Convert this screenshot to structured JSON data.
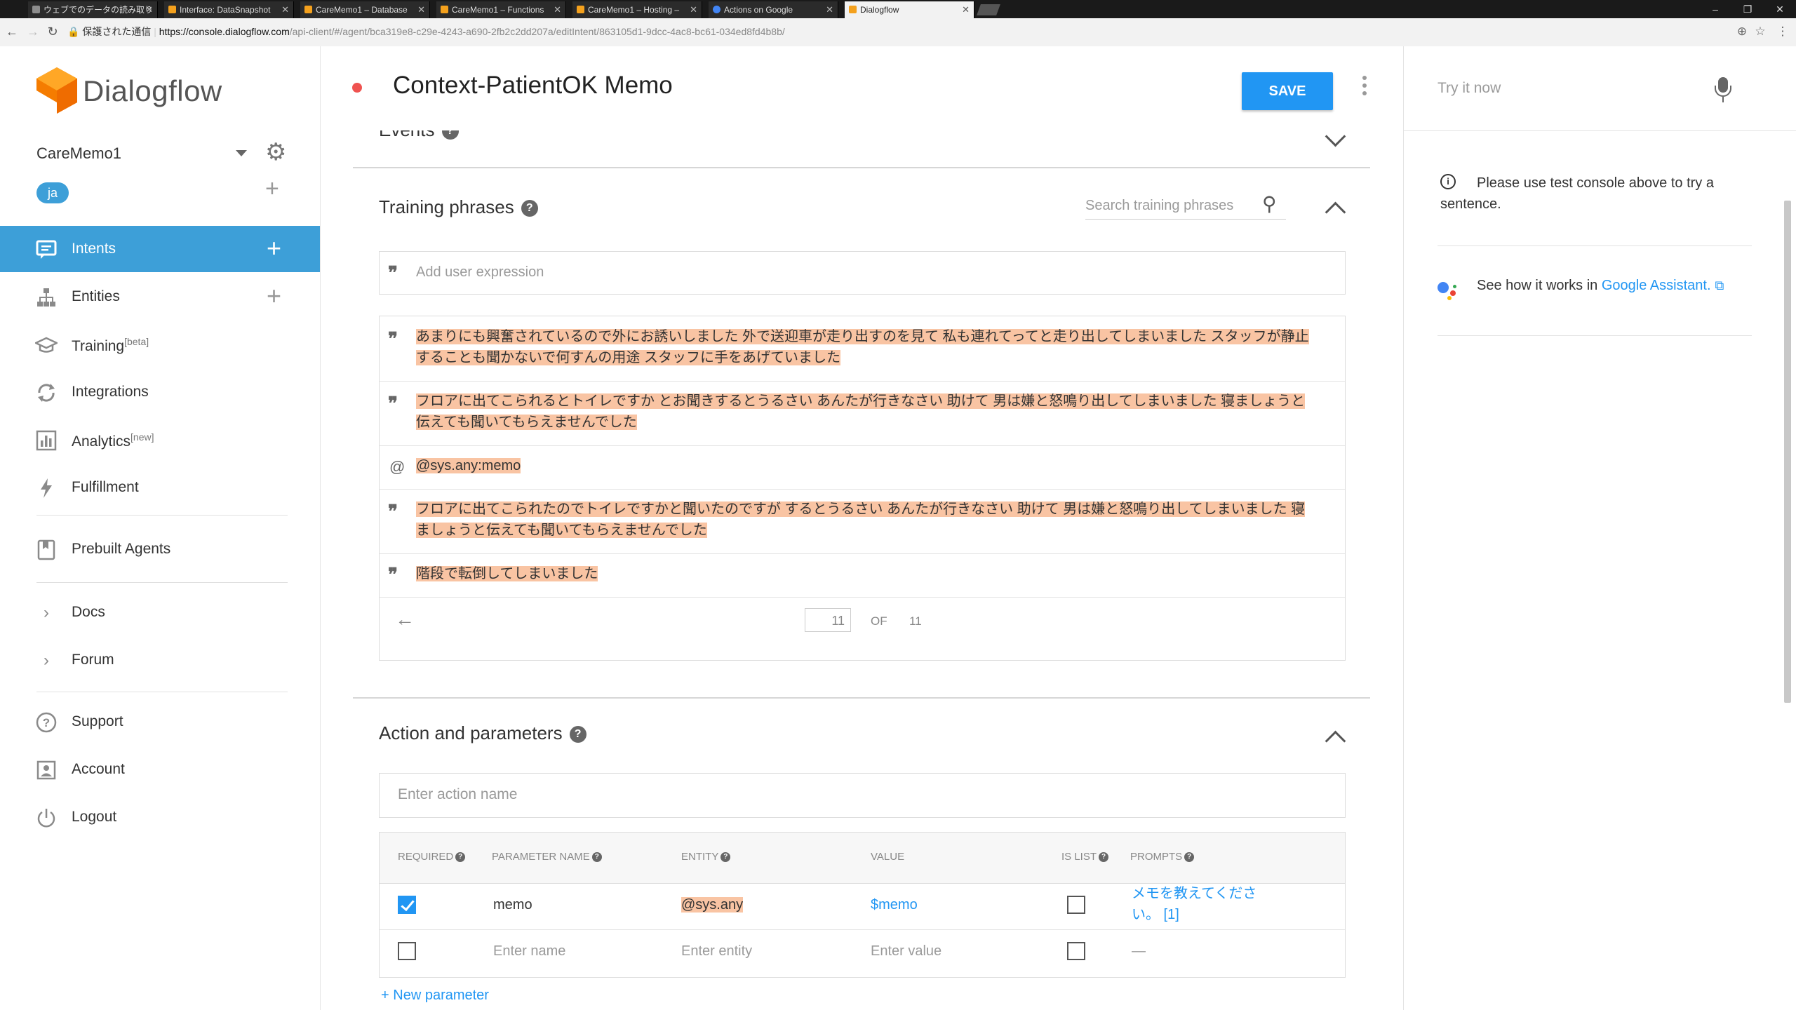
{
  "browser": {
    "tabs": [
      {
        "title": "ウェブでのデータの読み取り",
        "active": false
      },
      {
        "title": "Interface: DataSnapshot",
        "active": false
      },
      {
        "title": "CareMemo1 – Database",
        "active": false
      },
      {
        "title": "CareMemo1 – Functions",
        "active": false
      },
      {
        "title": "CareMemo1 – Hosting –",
        "active": false
      },
      {
        "title": "Actions on Google",
        "active": false
      },
      {
        "title": "Dialogflow",
        "active": true
      }
    ],
    "secure_label": "保護された通信",
    "url_domain": "https://console.dialogflow.com",
    "url_path": "/api-client/#/agent/bca319e8-c29e-4243-a690-2fb2c2dd207a/editIntent/863105d1-9dcc-4ac8-bc61-034ed8fd4b8b/"
  },
  "sidebar": {
    "brand": "Dialogflow",
    "agent_name": "CareMemo1",
    "language_chip": "ja",
    "nav": [
      {
        "label": "Intents",
        "icon": "chat-icon",
        "active": true,
        "has_add": true
      },
      {
        "label": "Entities",
        "icon": "hierarchy-icon",
        "active": false,
        "has_add": true
      },
      {
        "label": "Training",
        "badge": "[beta]",
        "icon": "graduation-cap-icon",
        "active": false
      },
      {
        "label": "Integrations",
        "icon": "sync-icon",
        "active": false
      },
      {
        "label": "Analytics",
        "badge": "[new]",
        "icon": "bar-chart-icon",
        "active": false
      },
      {
        "label": "Fulfillment",
        "icon": "lightning-icon",
        "active": false
      },
      {
        "label": "Prebuilt Agents",
        "icon": "bookmark-book-icon",
        "active": false
      },
      {
        "label": "Docs",
        "icon": "chevron-right-icon",
        "active": false
      },
      {
        "label": "Forum",
        "icon": "chevron-right-icon",
        "active": false
      },
      {
        "label": "Support",
        "icon": "help-circle-icon",
        "active": false
      },
      {
        "label": "Account",
        "icon": "account-box-icon",
        "active": false
      },
      {
        "label": "Logout",
        "icon": "power-icon",
        "active": false
      }
    ]
  },
  "header": {
    "intent_title": "Context-PatientOK Memo",
    "save_label": "SAVE"
  },
  "main": {
    "events_label": "Events",
    "training": {
      "title": "Training phrases",
      "search_placeholder": "Search training phrases",
      "add_placeholder": "Add user expression",
      "phrases": [
        {
          "type": "quote",
          "text": "あまりにも興奮されているので外にお誘いしました 外で送迎車が走り出すのを見て 私も連れてってと走り出してしまいました スタッフが静止することも聞かないで何すんの用途 スタッフに手をあげていました"
        },
        {
          "type": "quote",
          "text": "フロアに出てこられるとトイレですか とお聞きするとうるさい あんたが行きなさい 助けて 男は嫌と怒鳴り出してしまいました 寝ましょうと伝えても聞いてもらえませんでした"
        },
        {
          "type": "template",
          "text": "@sys.any:memo"
        },
        {
          "type": "quote",
          "text": "フロアに出てこられたのでトイレですかと聞いたのですが するとうるさい あんたが行きなさい 助けて 男は嫌と怒鳴り出してしまいました 寝ましょうと伝えても聞いてもらえませんでした"
        },
        {
          "type": "quote",
          "text": "階段で転倒してしまいました"
        }
      ],
      "pager": {
        "current": "11",
        "of_label": "OF",
        "total": "11"
      }
    },
    "action": {
      "title": "Action and parameters",
      "action_placeholder": "Enter action name",
      "columns": [
        "REQUIRED",
        "PARAMETER NAME",
        "ENTITY",
        "VALUE",
        "IS LIST",
        "PROMPTS"
      ],
      "rows": [
        {
          "required": true,
          "name": "memo",
          "entity": "@sys.any",
          "value": "$memo",
          "is_list": false,
          "prompts": "メモを教えてください。 [1]"
        },
        {
          "required": false,
          "name": "Enter name",
          "entity": "Enter entity",
          "value": "Enter value",
          "is_list": false,
          "prompts": "—"
        }
      ],
      "new_parameter_label": "New parameter"
    }
  },
  "right_panel": {
    "try_placeholder": "Try it now",
    "info_text": "Please use test console above to try a sentence.",
    "ga_prefix": "See how it works in ",
    "ga_link": "Google Assistant."
  },
  "colors": {
    "accent": "#2196f3",
    "sidebar_active": "#3d9fd8",
    "highlight": "#f9c4a3",
    "unsaved_dot": "#ef5350"
  }
}
